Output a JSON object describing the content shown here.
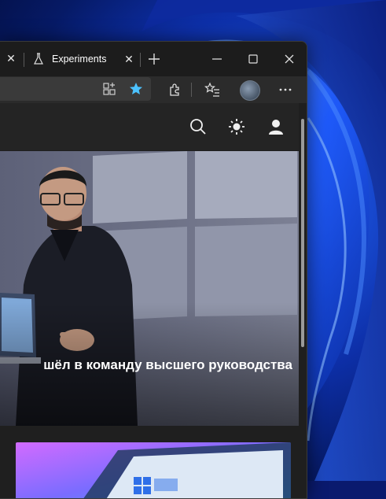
{
  "browser": {
    "tabs": [
      {
        "title": "Experiments",
        "icon": "flask-icon"
      }
    ],
    "buttons": {
      "new_tab": "plus-icon",
      "minimize": "minimize-icon",
      "maximize": "maximize-icon",
      "close": "close-icon"
    },
    "toolbar": {
      "icons": [
        "app-available-icon",
        "favorite-star-icon",
        "extensions-icon",
        "favorites-icon",
        "profile-avatar",
        "more-options-icon"
      ],
      "favorite_color": "#4cc2ff"
    }
  },
  "site": {
    "header_icons": [
      "search-icon",
      "theme-toggle-icon",
      "account-icon"
    ],
    "hero": {
      "title": "шёл в команду высшего руководства"
    }
  },
  "colors": {
    "window_bg": "#202020",
    "titlebar_bg": "#1c1c1c",
    "toolbar_bg": "#2b2b2b",
    "wallpaper_accent": "#1a4fd8"
  }
}
